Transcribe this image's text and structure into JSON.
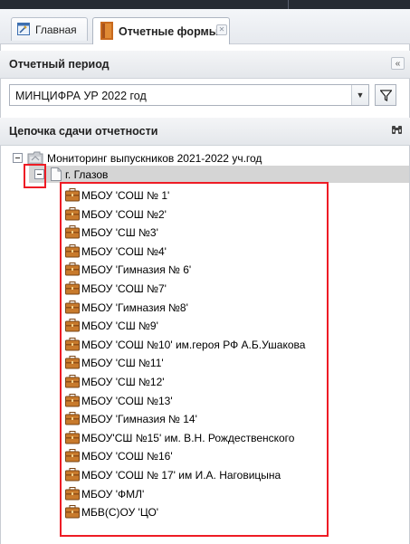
{
  "tabs": [
    {
      "label": "Главная"
    },
    {
      "label": "Отчетные формы"
    }
  ],
  "period_panel": {
    "title": "Отчетный период",
    "selected_value": "МИНЦИФРА УР 2022 год"
  },
  "chain_panel": {
    "title": "Цепочка сдачи отчетности"
  },
  "tree": {
    "root_label": "Мониторинг выпускников 2021-2022 уч.год",
    "city_label": "г. Глазов",
    "schools": [
      "МБОУ 'СОШ № 1'",
      "МБОУ 'СОШ №2'",
      "МБОУ 'СШ №3'",
      "МБОУ 'СОШ №4'",
      "МБОУ 'Гимназия № 6'",
      "МБОУ 'СОШ №7'",
      "МБОУ 'Гимназия №8'",
      "МБОУ 'СШ №9'",
      "МБОУ 'СОШ №10' им.героя РФ А.Б.Ушакова",
      "МБОУ 'СШ №11'",
      "МБОУ 'СШ №12'",
      "МБОУ 'СОШ №13'",
      "МБОУ 'Гимназия № 14'",
      "МБОУ'СШ №15' им. В.Н. Рождественского",
      "МБОУ 'СОШ №16'",
      "МБОУ 'СОШ № 17' им И.А. Наговицына",
      "МБОУ 'ФМЛ'",
      "МБВ(С)ОУ 'ЦО'"
    ]
  },
  "colors": {
    "highlight": "#ee1c25",
    "briefcase": "#b4651e",
    "selected_row": "#d5d5d5"
  },
  "icons": [
    "home-tab-icon",
    "report-forms-tab-icon",
    "close-icon",
    "collapse-icon",
    "dropdown-arrow-icon",
    "filter-icon",
    "binoculars-icon",
    "folder-icon",
    "document-icon",
    "briefcase-icon"
  ]
}
